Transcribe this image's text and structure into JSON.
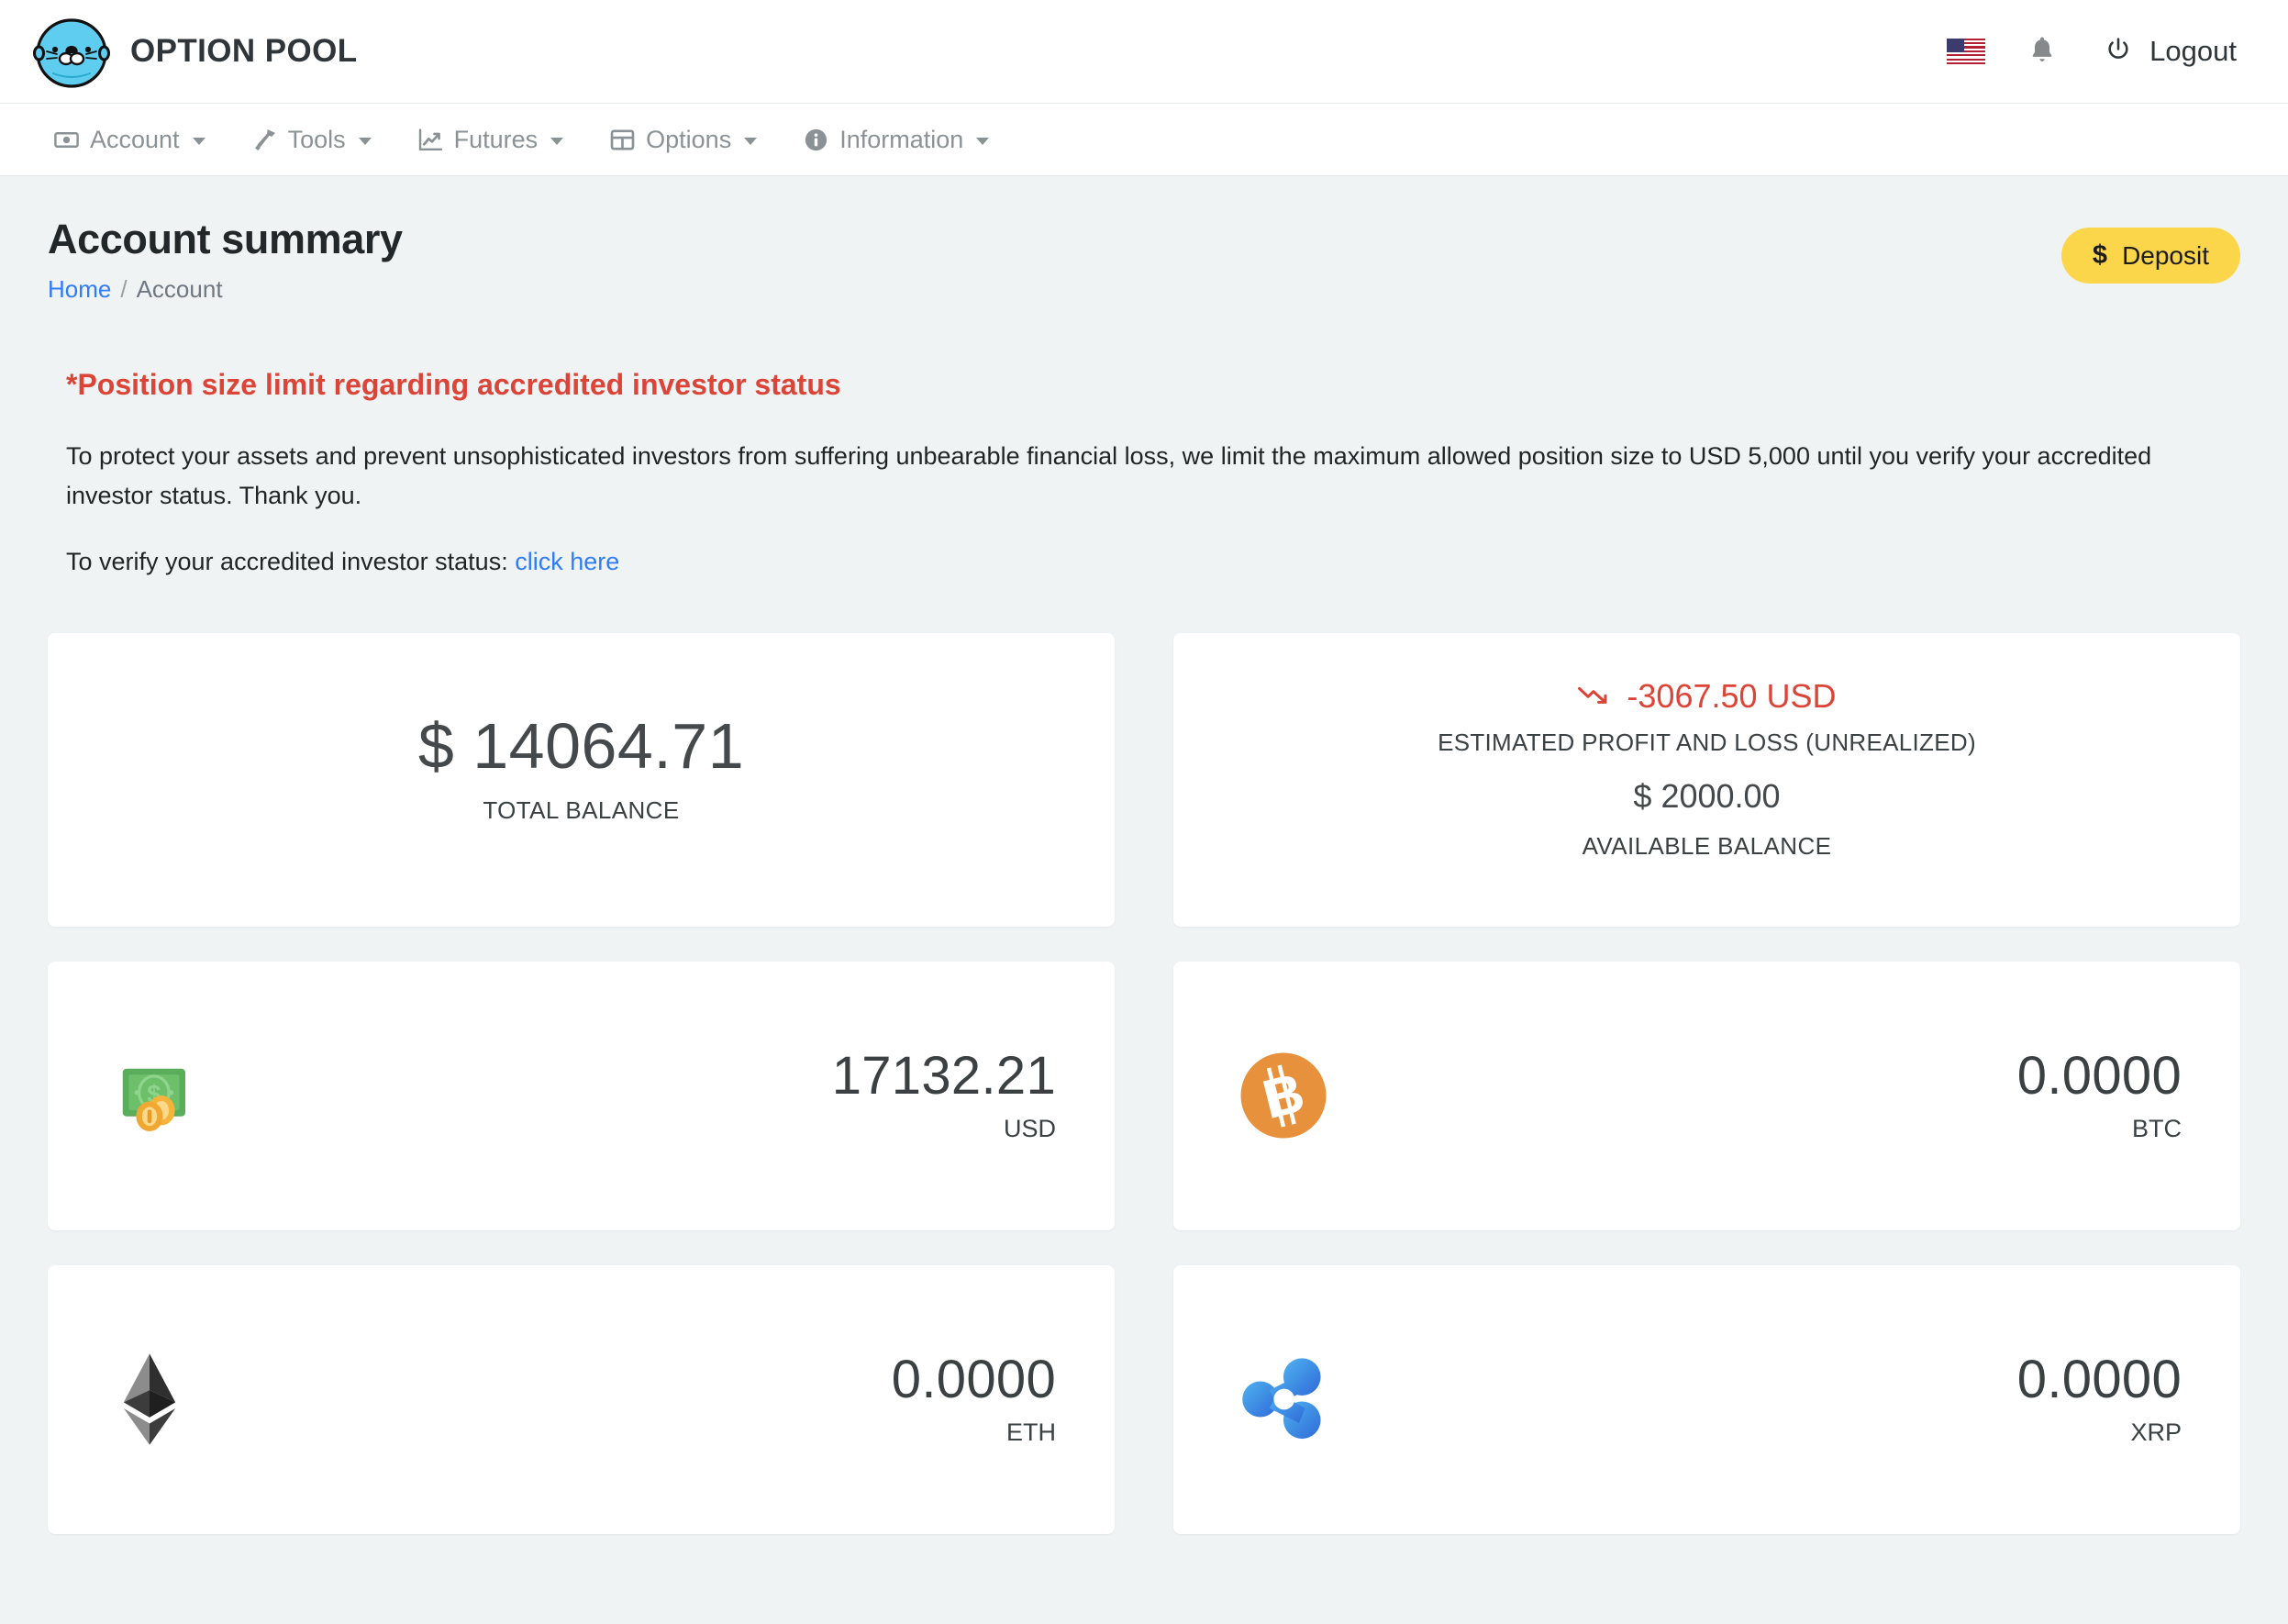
{
  "header": {
    "brand_name": "OPTION POOL",
    "logo_icon": "otter-face-logo",
    "flag_icon": "us-flag-icon",
    "bell_icon": "notification-bell-icon",
    "power_icon": "power-icon",
    "logout_label": "Logout"
  },
  "nav": {
    "items": [
      {
        "label": "Account",
        "icon": "banknote-icon"
      },
      {
        "label": "Tools",
        "icon": "hammer-icon"
      },
      {
        "label": "Futures",
        "icon": "line-chart-icon"
      },
      {
        "label": "Options",
        "icon": "table-grid-icon"
      },
      {
        "label": "Information",
        "icon": "info-circle-icon"
      }
    ]
  },
  "page": {
    "title": "Account summary",
    "breadcrumb": {
      "home": "Home",
      "separator": "/",
      "current": "Account"
    },
    "deposit_button": {
      "symbol": "$",
      "label": "Deposit"
    }
  },
  "notice": {
    "title": "*Position size limit regarding accredited investor status",
    "body": "To protect your assets and prevent unsophisticated investors from suffering unbearable financial loss, we limit the maximum allowed position size to USD 5,000 until you verify your accredited investor status. Thank you.",
    "verify_prefix": "To verify your accredited investor status:",
    "verify_link": "click here"
  },
  "summary": {
    "total": {
      "amount": "$ 14064.71",
      "label": "TOTAL BALANCE"
    },
    "pnl": {
      "trend_icon": "trend-down-icon",
      "amount": "-3067.50 USD",
      "label": "ESTIMATED PROFIT AND LOSS (UNREALIZED)",
      "available_amount": "$ 2000.00",
      "available_label": "AVAILABLE BALANCE",
      "color": "#dc4437"
    }
  },
  "balances": [
    {
      "icon": "usd-money-icon",
      "amount": "17132.21",
      "code": "USD"
    },
    {
      "icon": "bitcoin-icon",
      "amount": "0.0000",
      "code": "BTC"
    },
    {
      "icon": "ethereum-icon",
      "amount": "0.0000",
      "code": "ETH"
    },
    {
      "icon": "ripple-xrp-icon",
      "amount": "0.0000",
      "code": "XRP"
    }
  ],
  "colors": {
    "background": "#eff3f4",
    "card": "#ffffff",
    "accent_yellow": "#fbd64a",
    "link_blue": "#2f7cf6",
    "danger_red": "#dc4437",
    "bitcoin_orange": "#e8913c",
    "logo_blue": "#5ecdf0"
  }
}
